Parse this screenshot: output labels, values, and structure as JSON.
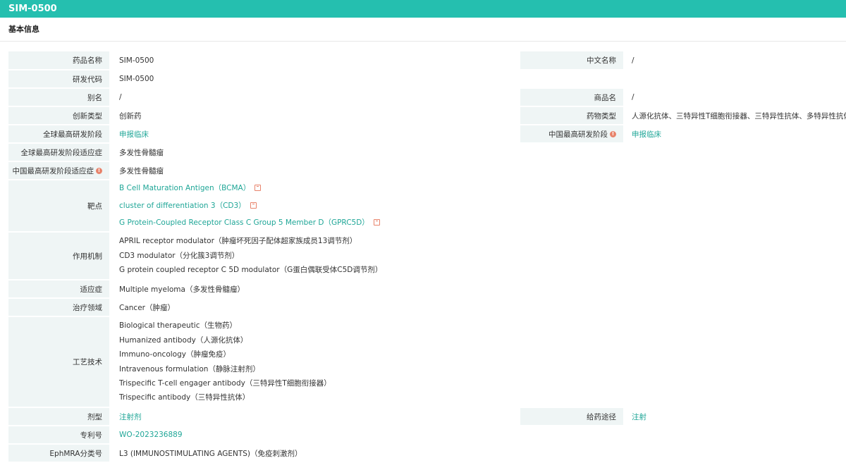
{
  "header": {
    "title": "SIM-0500"
  },
  "section": {
    "title": "基本信息"
  },
  "fields": {
    "drug_name": {
      "label": "药品名称",
      "value": "SIM-0500"
    },
    "cn_name": {
      "label": "中文名称",
      "value": "/"
    },
    "rd_code": {
      "label": "研发代码",
      "value": "SIM-0500"
    },
    "alias": {
      "label": "别名",
      "value": "/"
    },
    "trade_name": {
      "label": "商品名",
      "value": "/"
    },
    "innovation_type": {
      "label": "创新类型",
      "value": "创新药"
    },
    "drug_type": {
      "label": "药物类型",
      "value": "人源化抗体、三特异性T细胞衔接器、三特异性抗体、多特异性抗体"
    },
    "global_phase": {
      "label": "全球最高研发阶段",
      "value": "申报临床"
    },
    "china_phase": {
      "label": "中国最高研发阶段",
      "value": "申报临床"
    },
    "global_indication": {
      "label": "全球最高研发阶段适应症",
      "value": "多发性骨髓瘤"
    },
    "china_indication": {
      "label": "中国最高研发阶段适应症",
      "value": "多发性骨髓瘤"
    },
    "targets": {
      "label": "靶点",
      "items": [
        "B Cell Maturation Antigen（BCMA）",
        "cluster of differentiation 3（CD3）",
        "G Protein-Coupled Receptor Class C Group 5 Member D（GPRC5D）"
      ]
    },
    "mechanism": {
      "label": "作用机制",
      "items": [
        "APRIL receptor modulator（肿瘤坏死因子配体超家族成员13调节剂）",
        "CD3 modulator（分化簇3调节剂）",
        "G protein coupled receptor C 5D modulator（G蛋白偶联受体C5D调节剂）"
      ]
    },
    "indication": {
      "label": "适应症",
      "value": "Multiple myeloma（多发性骨髓瘤）"
    },
    "therapy_area": {
      "label": "治疗领域",
      "value": "Cancer（肿瘤）"
    },
    "technology": {
      "label": "工艺技术",
      "items": [
        "Biological therapeutic（生物药）",
        "Humanized antibody（人源化抗体）",
        "Immuno-oncology（肿瘤免疫）",
        "Intravenous formulation（静脉注射剂）",
        "Trispecific T-cell engager antibody（三特异性T细胞衔接器）",
        "Trispecific antibody（三特异性抗体）"
      ]
    },
    "dosage_form": {
      "label": "剂型",
      "value": "注射剂"
    },
    "route": {
      "label": "给药途径",
      "value": "注射"
    },
    "patent": {
      "label": "专利号",
      "value": "WO-2023236889"
    },
    "ephmra": {
      "label": "EphMRA分类号",
      "value": "L3 (IMMUNOSTIMULATING AGENTS)（免疫刺激剂）"
    }
  },
  "colors": {
    "accent": "#25bfaf",
    "link": "#1fa697",
    "label_bg": "#eff5f5",
    "icon": "#e8836b"
  }
}
